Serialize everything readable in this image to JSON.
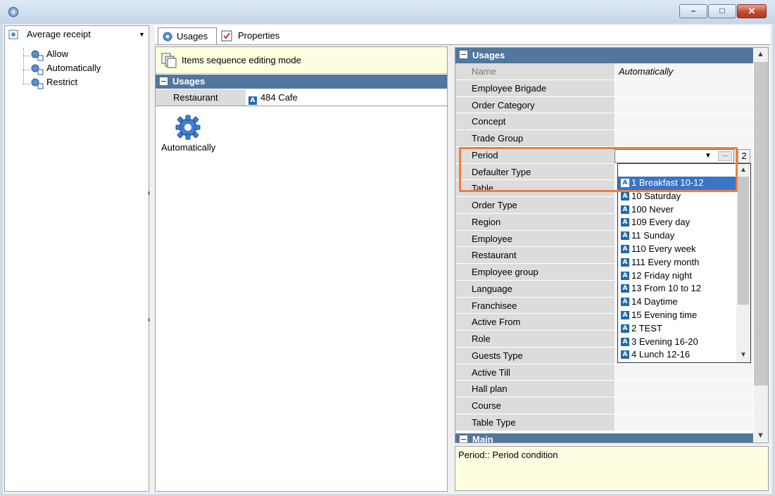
{
  "window": {
    "minimize_glyph": "–",
    "maximize_glyph": "□",
    "close_glyph": "✕"
  },
  "left_pane": {
    "selected": "Average receipt",
    "tree": [
      "Allow",
      "Automatically",
      "Restrict"
    ]
  },
  "tabs": [
    {
      "label": "Usages"
    },
    {
      "label": "Properties"
    }
  ],
  "middle": {
    "mode_label": "Items sequence editing mode",
    "section_title": "Usages",
    "row_key": "Restaurant",
    "row_value": "484 Cafe",
    "item_label": "Automatically"
  },
  "grid": {
    "section_title": "Usages",
    "rows": [
      {
        "key": "Name",
        "value": "Automatically"
      },
      {
        "key": "Employee Brigade",
        "value": ""
      },
      {
        "key": "Order Category",
        "value": ""
      },
      {
        "key": "Concept",
        "value": ""
      },
      {
        "key": "Trade Group",
        "value": ""
      },
      {
        "key": "Period",
        "value": ""
      },
      {
        "key": "Defaulter Type",
        "value": ""
      },
      {
        "key": "Table",
        "value": ""
      },
      {
        "key": "Order Type",
        "value": ""
      },
      {
        "key": "Region",
        "value": ""
      },
      {
        "key": "Employee",
        "value": ""
      },
      {
        "key": "Restaurant",
        "value": ""
      },
      {
        "key": "Employee group",
        "value": ""
      },
      {
        "key": "Language",
        "value": ""
      },
      {
        "key": "Franchisee",
        "value": ""
      },
      {
        "key": "Active From",
        "value": ""
      },
      {
        "key": "Role",
        "value": ""
      },
      {
        "key": "Guests Type",
        "value": ""
      },
      {
        "key": "Active Till",
        "value": ""
      },
      {
        "key": "Hall plan",
        "value": ""
      },
      {
        "key": "Course",
        "value": ""
      },
      {
        "key": "Table Type",
        "value": ""
      }
    ],
    "next_section": "Main",
    "period_count": "2"
  },
  "dropdown": {
    "items": [
      "1 Breakfast 10-12",
      "10 Saturday",
      "100 Never",
      "109 Every day",
      "11 Sunday",
      "110 Every week",
      "111 Every month",
      "12 Friday night",
      "13 From 10 to 12",
      "14 Daytime",
      "15 Evening time",
      "2 TEST",
      "3 Evening 16-20",
      "4 Lunch 12-16"
    ],
    "selected_index": 0
  },
  "description": "Period:: Period condition",
  "colors": {
    "section_header": "#52779e",
    "highlight": "#ee7d3f",
    "selection": "#3a75c4"
  }
}
